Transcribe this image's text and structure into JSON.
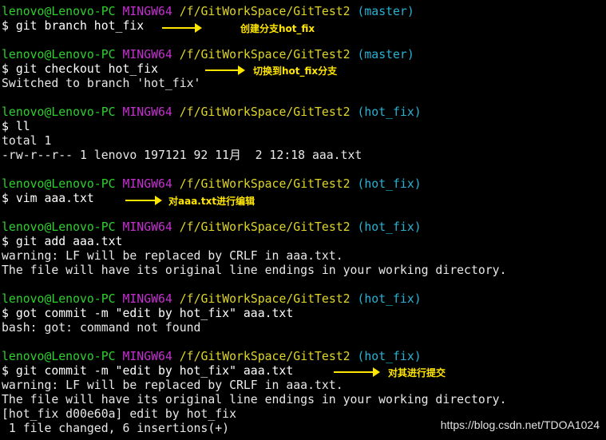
{
  "prompt": {
    "user": "lenovo@Lenovo-PC",
    "system": "MINGW64",
    "path": "/f/GitWorkSpace/GitTest2",
    "branch_master": "(master)",
    "branch_hotfix": "(hot_fix)"
  },
  "lines": {
    "cmd1": "$ git branch hot_fix",
    "cmd2": "$ git checkout hot_fix",
    "out2": "Switched to branch 'hot_fix'",
    "cmd3": "$ ll",
    "out3a": "total 1",
    "out3b": "-rw-r--r-- 1 lenovo 197121 92 11月  2 12:18 aaa.txt",
    "cmd4": "$ vim aaa.txt",
    "cmd5": "$ git add aaa.txt",
    "out5a": "warning: LF will be replaced by CRLF in aaa.txt.",
    "out5b": "The file will have its original line endings in your working directory.",
    "cmd6": "$ got commit -m \"edit by hot_fix\" aaa.txt",
    "out6": "bash: got: command not found",
    "cmd7": "$ git commit -m \"edit by hot_fix\" aaa.txt",
    "out7a": "warning: LF will be replaced by CRLF in aaa.txt.",
    "out7b": "The file will have its original line endings in your working directory.",
    "out7c": "[hot_fix d00e60a] edit by hot_fix",
    "out7d": " 1 file changed, 6 insertions(+)"
  },
  "annotations": {
    "create_branch": "创建分支hot_fix",
    "switch_branch": "切换到hot_fix分支",
    "edit_file": "对aaa.txt进行编辑",
    "commit": "对其进行提交"
  },
  "watermark": "https://blog.csdn.net/TDOA1024",
  "colors": {
    "background": "#000000",
    "user": "#2cd12c",
    "system": "#c52fd1",
    "path": "#e0d62a",
    "branch": "#26b3d6",
    "annotation": "#ffe600"
  }
}
